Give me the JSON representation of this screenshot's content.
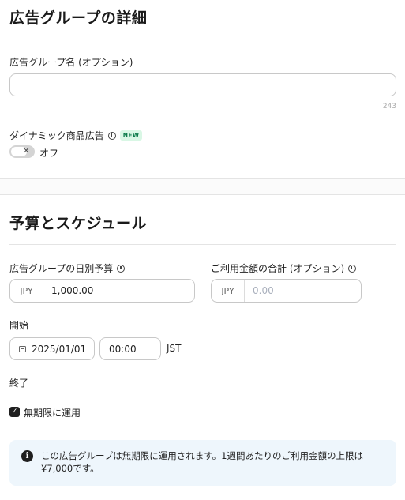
{
  "ad_group_details": {
    "title": "広告グループの詳細",
    "name_label": "広告グループ名 (オプション)",
    "name_value": "",
    "char_remaining": "243",
    "dynamic_ads_label": "ダイナミック商品広告",
    "new_badge": "NEW",
    "toggle_state_label": "オフ",
    "toggle_on": false
  },
  "budget_schedule": {
    "title": "予算とスケジュール",
    "daily_budget_label": "広告グループの日別予算",
    "daily_budget_currency": "JPY",
    "daily_budget_value": "1,000.00",
    "total_spend_label": "ご利用金額の合計 (オプション)",
    "total_spend_currency": "JPY",
    "total_spend_placeholder": "0.00",
    "start_label": "開始",
    "start_date": "2025/01/01",
    "start_time": "00:00",
    "timezone": "JST",
    "end_label": "終了",
    "run_indefinitely_label": "無期限に運用",
    "run_indefinitely_checked": true,
    "notice_text": "この広告グループは無期限に運用されます。1週間あたりのご利用金額の上限は ¥7,000です。"
  },
  "icons": {
    "info": "info-icon",
    "calendar": "calendar-icon",
    "notice": "info-filled-icon",
    "check": "checkmark-icon"
  },
  "colors": {
    "new_badge_bg": "#d9f7e5",
    "new_badge_text": "#0c7a4a",
    "notice_bg": "#eef6fc",
    "toggle_off": "#d4d4d4"
  }
}
